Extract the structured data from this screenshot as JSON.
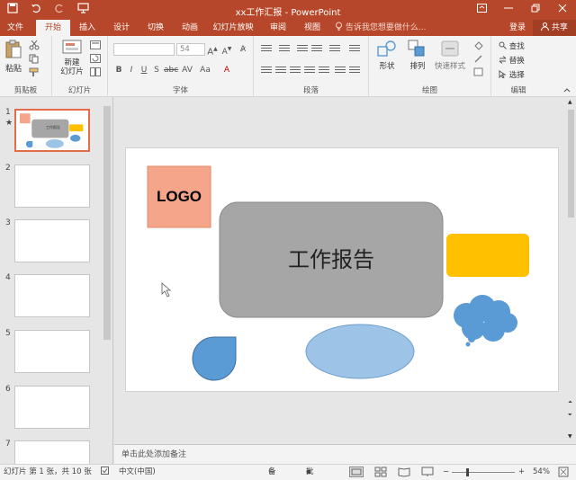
{
  "title_bar": {
    "doc_title": "xx工作汇报 - PowerPoint",
    "qat_icons": [
      "save-icon",
      "undo-icon",
      "redo-icon",
      "start-slideshow-icon"
    ]
  },
  "tabs": [
    {
      "label": "文件",
      "active": false
    },
    {
      "label": "开始",
      "active": true
    },
    {
      "label": "插入",
      "active": false
    },
    {
      "label": "设计",
      "active": false
    },
    {
      "label": "切换",
      "active": false
    },
    {
      "label": "动画",
      "active": false
    },
    {
      "label": "幻灯片放映",
      "active": false
    },
    {
      "label": "审阅",
      "active": false
    },
    {
      "label": "视图",
      "active": false
    }
  ],
  "tellme_placeholder": "告诉我您想要做什么...",
  "account": {
    "login": "登录",
    "share": "共享"
  },
  "ribbon": {
    "clipboard": {
      "label": "剪贴板",
      "paste": "粘贴"
    },
    "slides": {
      "label": "幻灯片",
      "new_slide": "新建\n幻灯片"
    },
    "font": {
      "label": "字体",
      "font_name": "",
      "font_size": "54"
    },
    "paragraph": {
      "label": "段落"
    },
    "drawing": {
      "label": "绘图",
      "shape": "形状",
      "arrange": "排列",
      "quick_styles": "快速样式"
    },
    "editing": {
      "label": "编辑",
      "find": "查找",
      "replace": "替换",
      "select": "选择"
    }
  },
  "thumbnails": [
    "1",
    "2",
    "3",
    "4",
    "5",
    "6",
    "7"
  ],
  "slide": {
    "logo_text": "LOGO",
    "title_text": "工作报告",
    "colors": {
      "logo_fill": "#f4a58a",
      "main_rect": "#a6a6a6",
      "yellow_rect": "#ffc000",
      "blue": "#5b9bd5",
      "ellipse": "#9dc3e6"
    }
  },
  "thumb_title_text": "工作报告",
  "notes_placeholder": "单击此处添加备注",
  "status": {
    "slide_info": "幻灯片 第 1 张，共 10 张",
    "language": "中文(中国)",
    "notes": "备注",
    "comments": "批注",
    "zoom": "54%"
  }
}
